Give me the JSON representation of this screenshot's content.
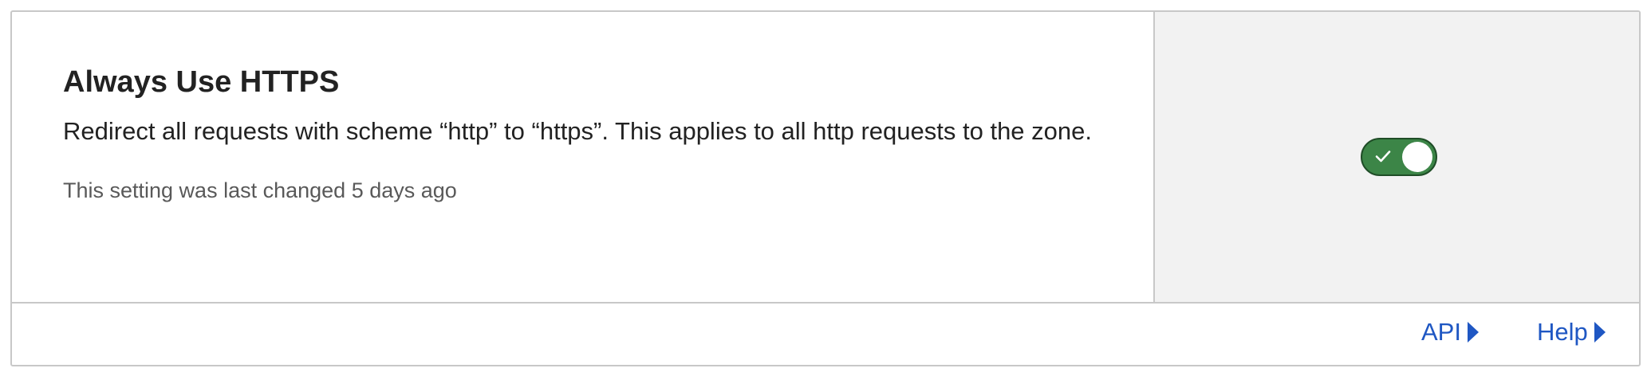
{
  "setting": {
    "title": "Always Use HTTPS",
    "description": "Redirect all requests with scheme “http” to “https”. This applies to all http requests to the zone.",
    "last_changed": "This setting was last changed 5 days ago",
    "enabled": true
  },
  "footer": {
    "links": [
      {
        "label": "API",
        "icon": "caret-right-icon"
      },
      {
        "label": "Help",
        "icon": "caret-right-icon"
      }
    ]
  },
  "colors": {
    "toggle_on": "#3c8547",
    "link": "#1f57c3",
    "control_pane_bg": "#f2f2f2"
  }
}
